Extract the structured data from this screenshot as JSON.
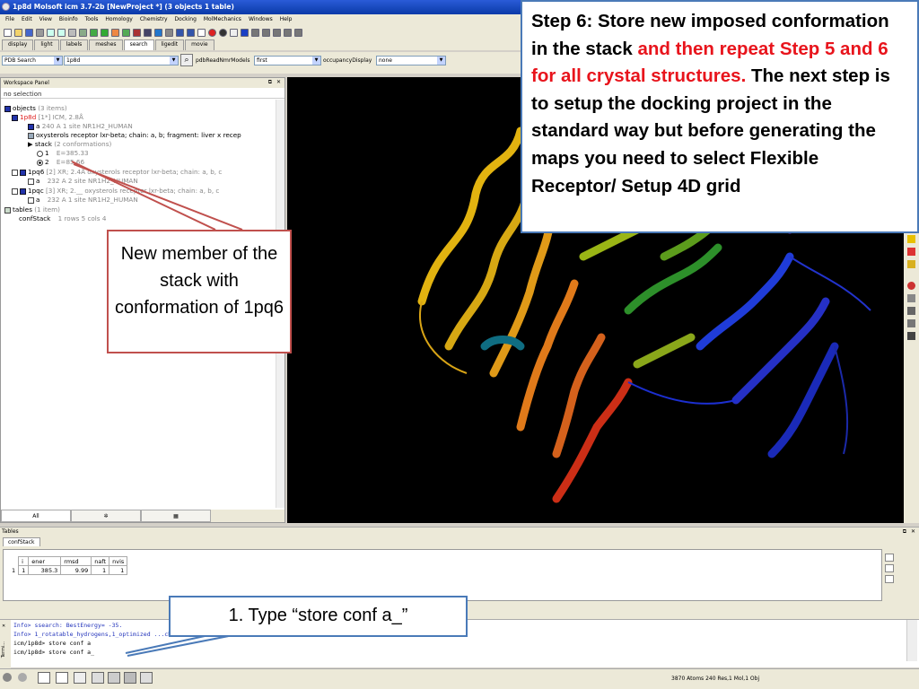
{
  "window": {
    "title": "1p8d Molsoft icm 3.7-2b  [NewProject *] (3 objects 1 table)"
  },
  "menu": [
    "File",
    "Edit",
    "View",
    "Bioinfo",
    "Tools",
    "Homology",
    "Chemistry",
    "Docking",
    "MolMechanics",
    "Windows",
    "Help"
  ],
  "tabs": [
    "display",
    "light",
    "labels",
    "meshes",
    "search",
    "ligedit",
    "movie"
  ],
  "active_tab": "search",
  "search": {
    "source_label": "PDB Search",
    "query": "1p8d",
    "read_nmr_label": "pdbReadNmrModels",
    "read_nmr_value": "first",
    "occupancy_label": "occupancyDisplay",
    "occupancy_value": "none"
  },
  "workspace": {
    "title": "Workspace Panel",
    "selection": "no selection",
    "tree": [
      {
        "label": "objects",
        "info": "(3 items)"
      },
      {
        "label": "1p8d",
        "info": "[1*] ICM, 2.8Å"
      },
      {
        "label": "a",
        "info": "240 A  1 site NR1H2_HUMAN"
      },
      {
        "label": "oxysterols receptor lxr-beta; chain: a, b; fragment: liver x recep",
        "info": ""
      },
      {
        "label": "stack",
        "info": "(2 conformations)"
      },
      {
        "label": "1",
        "info": "E=385.33"
      },
      {
        "label": "2",
        "info": "E=85.66"
      },
      {
        "label": "1pq6",
        "info": "[2] XR; 2.4Å  oxysterols receptor lxr-beta; chain: a, b, c"
      },
      {
        "label": "a",
        "info": "232 A  2 site NR1H2_HUMAN"
      },
      {
        "label": "1pqc",
        "info": "[3] XR; 2.__  oxysterols receptor lxr-beta; chain: a, b, c"
      },
      {
        "label": "a",
        "info": "232 A  1 site NR1H2_HUMAN"
      },
      {
        "label": "tables",
        "info": "(1 item)"
      },
      {
        "label": "confStack",
        "info": "1 rows 5 cols 4"
      }
    ],
    "bottom_tabs": [
      "All",
      "",
      ""
    ]
  },
  "tables": {
    "title": "Tables",
    "tab": "confStack",
    "columns": [
      "i",
      "ener",
      "rmsd",
      "naft",
      "nvis"
    ],
    "rows": [
      [
        "1",
        "385.3",
        "9.99",
        "1",
        "1"
      ]
    ],
    "row_index": "1"
  },
  "terminal": {
    "lines": [
      "Info> ssearch: BestEnergy=   -35.",
      "Info> 1_rotatable_hydrogens,1_optimized                    ...chm/variables defined",
      "icm/1p8d> store conf a",
      "icm/1p8d> store conf a_"
    ],
    "side_label": "Termi..."
  },
  "status": {
    "text": "3870 Atoms 240 Res,1 Mol,1 Obj"
  },
  "callouts": {
    "step6_part1": "Step 6: Store new imposed conformation in the stack ",
    "step6_red": "and then repeat Step 5 and 6 for all crystal structures.",
    "step6_part2": " The next step is to setup the docking project in the standard way but before generating the maps you need to select Flexible Receptor/ Setup 4D grid",
    "new_member": "New member of the stack with conformation of 1pq6",
    "type_cmd": "1. Type “store conf a_”"
  },
  "colors": {
    "titlebar": "#0a3aa8",
    "accent_red": "#e8141c",
    "callout_blue": "#4a7ab8",
    "callout_red": "#c0504d",
    "viewer_bg": "#000000"
  }
}
